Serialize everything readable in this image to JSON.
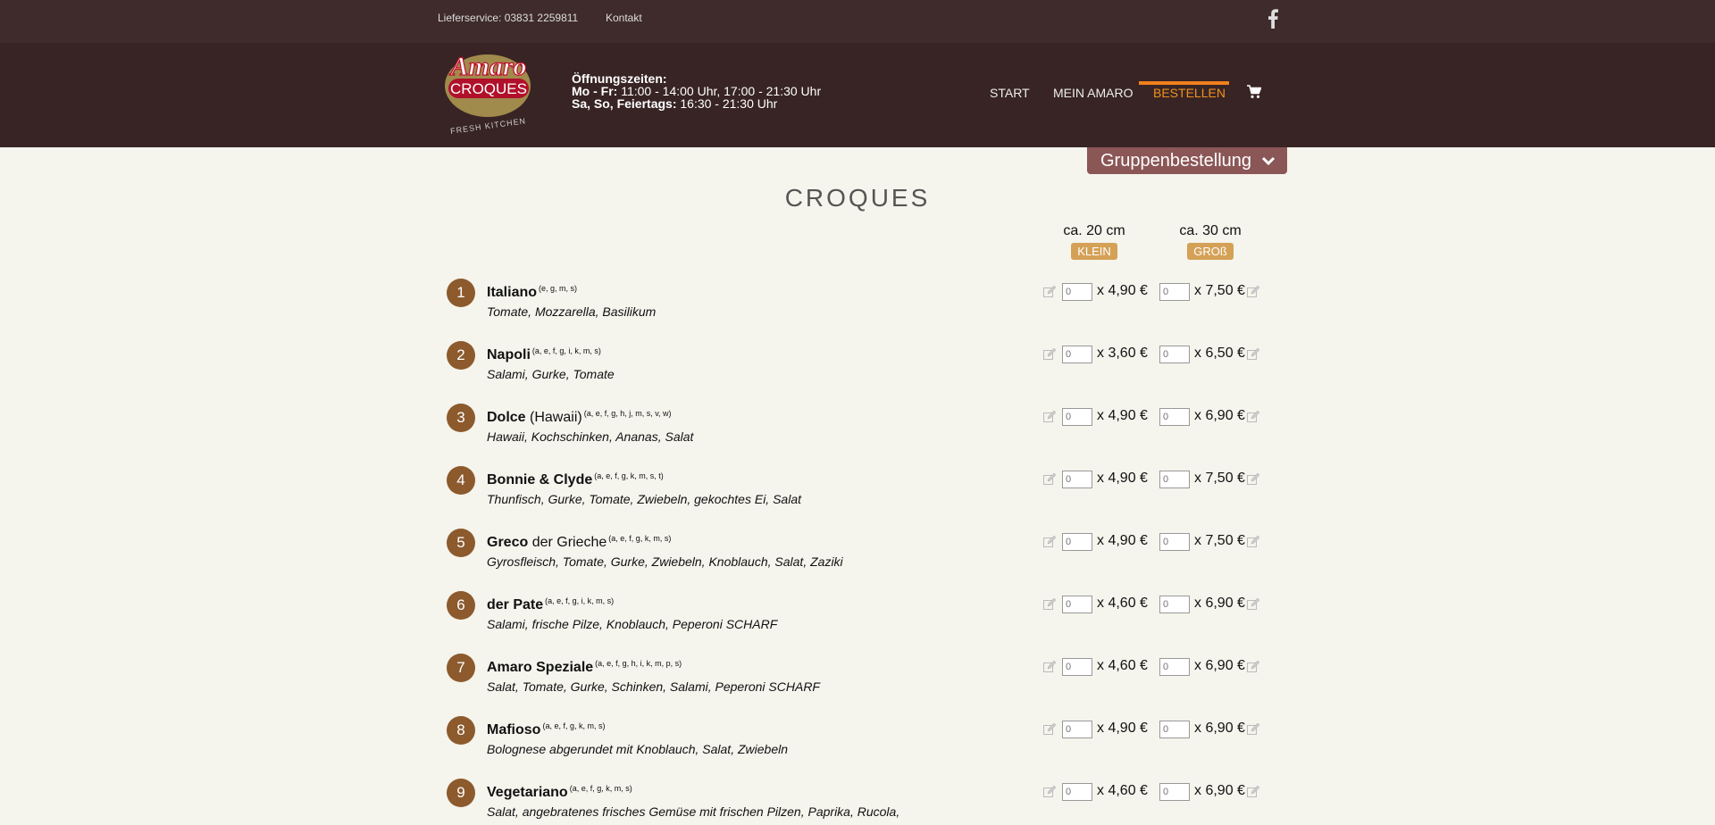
{
  "topbar": {
    "delivery": "Lieferservice: 03831 2259811",
    "contact": "Kontakt"
  },
  "header": {
    "logo": {
      "brand": "Amaro",
      "sub": "CROQUES",
      "tag": "FRESH KITCHEN"
    },
    "hours": {
      "title": "Öffnungszeiten:",
      "line1_label": "Mo - Fr:",
      "line1_value": " 11:00 - 14:00 Uhr, 17:00 - 21:30 Uhr",
      "line2_label": "Sa, So, Feiertags:",
      "line2_value": " 16:30 - 21:30 Uhr"
    },
    "nav": [
      {
        "label": "START"
      },
      {
        "label": "MEIN AMARO"
      },
      {
        "label": "BESTELLEN"
      }
    ]
  },
  "group_button": "Gruppenbestellung",
  "page_title": "CROQUES",
  "sizes": [
    {
      "size": "ca. 20 cm",
      "badge": "KLEIN"
    },
    {
      "size": "ca. 30 cm",
      "badge": "GROß"
    }
  ],
  "qty_placeholder": "0",
  "items": [
    {
      "num": "1",
      "name": "Italiano",
      "extra": "",
      "allergens": "(e, g, m, s)",
      "desc": "Tomate, Mozzarella, Basilikum",
      "price_small": "x 4,90 €",
      "price_large": "x 7,50 €"
    },
    {
      "num": "2",
      "name": "Napoli",
      "extra": "",
      "allergens": "(a, e, f, g, i, k, m, s)",
      "desc": "Salami, Gurke, Tomate",
      "price_small": "x 3,60 €",
      "price_large": "x 6,50 €"
    },
    {
      "num": "3",
      "name": "Dolce",
      "extra": " (Hawaii)",
      "allergens": "(a, e, f, g, h, j, m, s, v, w)",
      "desc": "Hawaii, Kochschinken, Ananas, Salat",
      "price_small": "x 4,90 €",
      "price_large": "x 6,90 €"
    },
    {
      "num": "4",
      "name": "Bonnie & Clyde",
      "extra": "",
      "allergens": "(a, e, f, g, k, m, s, t)",
      "desc": "Thunfisch, Gurke, Tomate, Zwiebeln, gekochtes Ei, Salat",
      "price_small": "x 4,90 €",
      "price_large": "x 7,50 €"
    },
    {
      "num": "5",
      "name": "Greco",
      "extra": " der Grieche",
      "allergens": "(a, e, f, g, k, m, s)",
      "desc": "Gyrosfleisch, Tomate, Gurke, Zwiebeln, Knoblauch, Salat, Zaziki",
      "price_small": "x 4,90 €",
      "price_large": "x 7,50 €"
    },
    {
      "num": "6",
      "name": "der Pate",
      "extra": "",
      "allergens": "(a, e, f, g, i, k, m, s)",
      "desc": "Salami, frische Pilze, Knoblauch, Peperoni SCHARF",
      "price_small": "x 4,60 €",
      "price_large": "x 6,90 €"
    },
    {
      "num": "7",
      "name": "Amaro Speziale",
      "extra": "",
      "allergens": "(a, e, f, g, h, i, k, m, p, s)",
      "desc": "Salat, Tomate, Gurke, Schinken, Salami, Peperoni SCHARF",
      "price_small": "x 4,60 €",
      "price_large": "x 6,90 €"
    },
    {
      "num": "8",
      "name": "Mafioso",
      "extra": "",
      "allergens": "(a, e, f, g, k, m, s)",
      "desc": "Bolognese abgerundet mit Knoblauch, Salat, Zwiebeln",
      "price_small": "x 4,90 €",
      "price_large": "x 6,90 €"
    },
    {
      "num": "9",
      "name": "Vegetariano",
      "extra": "",
      "allergens": "(a, e, f, g, k, m, s)",
      "desc": "Salat, angebratenes frisches Gemüse mit frischen Pilzen, Paprika, Rucola,",
      "price_small": "x 4,60 €",
      "price_large": "x 6,90 €"
    }
  ]
}
